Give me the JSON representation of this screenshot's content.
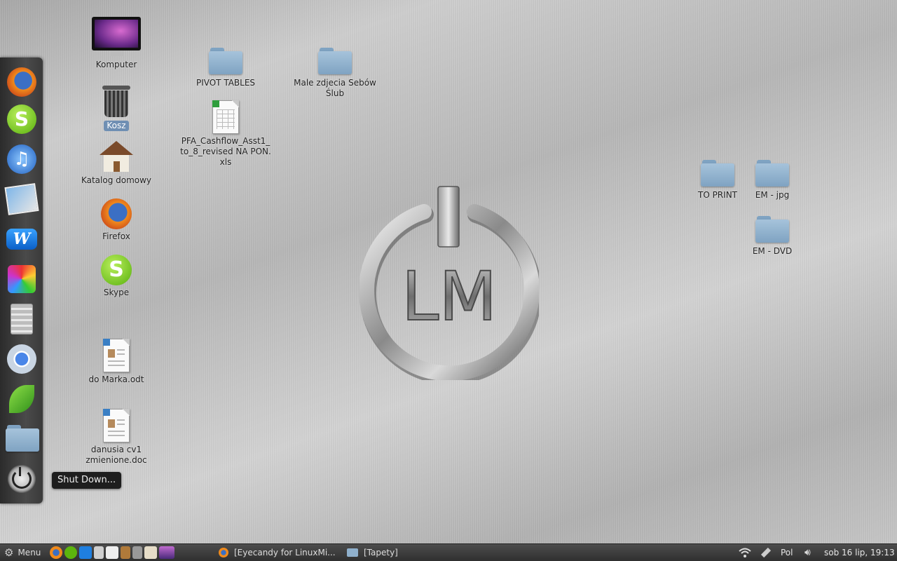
{
  "desktop": {
    "icons": [
      {
        "label": "Komputer"
      },
      {
        "label": "Kosz"
      },
      {
        "label": "Katalog domowy"
      },
      {
        "label": "Firefox"
      },
      {
        "label": "Skype"
      },
      {
        "label": "do Marka.odt"
      },
      {
        "label": "danusia cv1\nzmienione.doc"
      },
      {
        "label": "PIVOT TABLES"
      },
      {
        "label": "PFA_Cashflow_Asst1_\nto_8_revised NA PON.\nxls"
      },
      {
        "label": "Male zdjecia Sebów\nŚlub"
      },
      {
        "label": "TO PRINT"
      },
      {
        "label": "EM - jpg"
      },
      {
        "label": "EM - DVD"
      }
    ],
    "logo_text": "LM"
  },
  "dock": {
    "items": [
      "firefox-icon",
      "skype-icon",
      "itunes-icon",
      "iphoto-icon",
      "wine-icon",
      "paint-icon",
      "calculator-icon",
      "chrome-icon",
      "leaf-icon",
      "folder-icon",
      "shutdown-icon"
    ],
    "tooltip": "Shut Down..."
  },
  "taskbar": {
    "menu_label": "Menu",
    "windows": [
      {
        "label": "[Eyecandy for LinuxMi..."
      },
      {
        "label": "[Tapety]"
      }
    ],
    "keyboard_layout": "Pol",
    "clock": "sob 16 lip, 19:13"
  },
  "colors": {
    "folder": "#8fb0cc",
    "taskbar": "#3a3a3a",
    "selection": "#6f8fb3"
  }
}
